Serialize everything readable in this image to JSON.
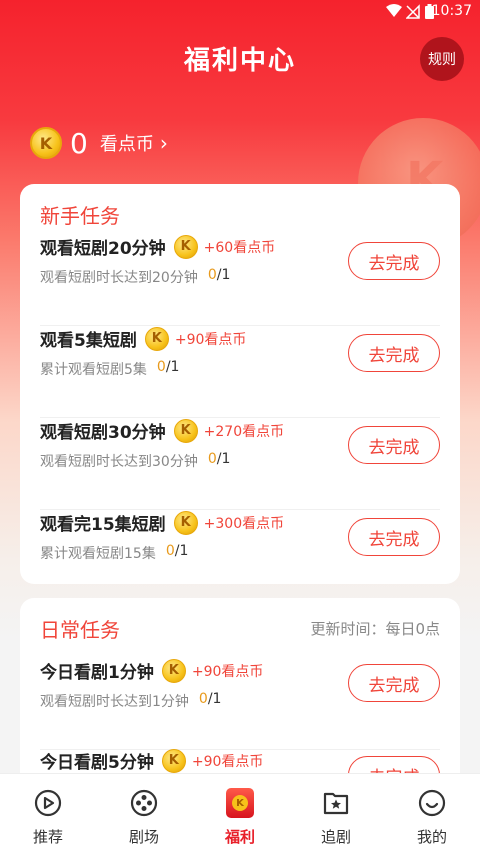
{
  "status_bar": {
    "time": "10:37"
  },
  "header": {
    "title": "福利中心",
    "rules_label": "规则"
  },
  "coins": {
    "icon": "coin-k-icon",
    "coin_letter": "K",
    "count": "0",
    "label": "看点币",
    "chevron": "›"
  },
  "new_tasks": {
    "title": "新手任务",
    "items": [
      {
        "name": "观看短剧20分钟",
        "reward": "+60看点币",
        "desc": "观看短剧时长达到20分钟",
        "current": "0",
        "total": "/1",
        "button": "去完成"
      },
      {
        "name": "观看5集短剧",
        "reward": "+90看点币",
        "desc": "累计观看短剧5集",
        "current": "0",
        "total": "/1",
        "button": "去完成"
      },
      {
        "name": "观看短剧30分钟",
        "reward": "+270看点币",
        "desc": "观看短剧时长达到30分钟",
        "current": "0",
        "total": "/1",
        "button": "去完成"
      },
      {
        "name": "观看完15集短剧",
        "reward": "+300看点币",
        "desc": "累计观看短剧15集",
        "current": "0",
        "total": "/1",
        "button": "去完成"
      }
    ]
  },
  "daily_tasks": {
    "title": "日常任务",
    "update_time": "更新时间：每日0点",
    "items": [
      {
        "name": "今日看剧1分钟",
        "reward": "+90看点币",
        "desc": "观看短剧时长达到1分钟",
        "current": "0",
        "total": "/1",
        "button": "去完成"
      },
      {
        "name": "今日看剧5分钟",
        "reward": "+90看点币",
        "desc": "",
        "current": "",
        "total": "",
        "button": "去完成"
      }
    ]
  },
  "tabbar": {
    "items": [
      {
        "label": "推荐",
        "icon": "play-circle-icon"
      },
      {
        "label": "剧场",
        "icon": "film-reel-icon"
      },
      {
        "label": "福利",
        "icon": "welfare-coin-icon",
        "active": true
      },
      {
        "label": "追剧",
        "icon": "star-folder-icon"
      },
      {
        "label": "我的",
        "icon": "smiley-icon"
      }
    ]
  },
  "colors": {
    "brand_red": "#f5222d",
    "accent_red": "#f0453a",
    "coin_gold": "#f7c21a",
    "progress_orange": "#e89a1c"
  }
}
